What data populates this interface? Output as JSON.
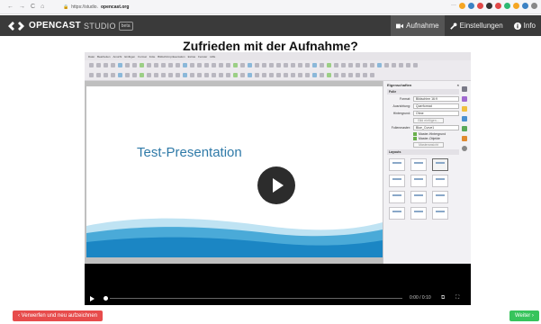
{
  "browser": {
    "nav": [
      "←",
      "→",
      "C",
      "⌂"
    ],
    "url_prefix": "https://studio.",
    "url_domain": "opencast.org",
    "overflow": "···",
    "ext_colors": [
      "#f5a623",
      "#3b82c4",
      "#e04848",
      "#333333",
      "#e04848",
      "#2eb872",
      "#f5a623",
      "#3b82c4",
      "#888888"
    ]
  },
  "app": {
    "brand": "OPENCAST",
    "studio": "STUDIO",
    "beta": "beta",
    "menu": [
      {
        "label": "Aufnahme",
        "icon": "video-icon",
        "active": true
      },
      {
        "label": "Einstellungen",
        "icon": "wrench-icon",
        "active": false
      },
      {
        "label": "Info",
        "icon": "info-icon",
        "active": false
      }
    ]
  },
  "page": {
    "title": "Zufrieden mit der Aufnahme?"
  },
  "libreoffice": {
    "menu": [
      "Datei",
      "Bearbeiten",
      "Ansicht",
      "Einfügen",
      "Format",
      "Folie",
      "Bildschirmpräsentation",
      "Extras",
      "Fenster",
      "Hilfe"
    ],
    "slide_title": "Test-Presentation",
    "sidebar": {
      "heading": "Eigenschaften",
      "section_folie": "Folie",
      "format_label": "Format:",
      "format_value": "Bildschirm 16:9",
      "ausrichtung_label": "Ausrichtung:",
      "ausrichtung_value": "Querformat",
      "hintergrund_label": "Hintergrund:",
      "hintergrund_value": "Ohne",
      "bild_einfuegen": "Bild einfügen...",
      "vorlage_label": "Folienmaster:",
      "vorlage_value": "Blue_Curve1",
      "chk1": "Master-Hintergrund",
      "chk2": "Master-Objekte",
      "mastersicht": "Masteransicht",
      "section_layouts": "Layouts"
    }
  },
  "player": {
    "time": "0:00 / 0:10",
    "pip_icon": "picture-in-picture-icon",
    "fullscreen_icon": "fullscreen-icon"
  },
  "actions": {
    "discard": "‹ Verwerfen und neu aufzeichnen",
    "next": "Weiter ›"
  }
}
